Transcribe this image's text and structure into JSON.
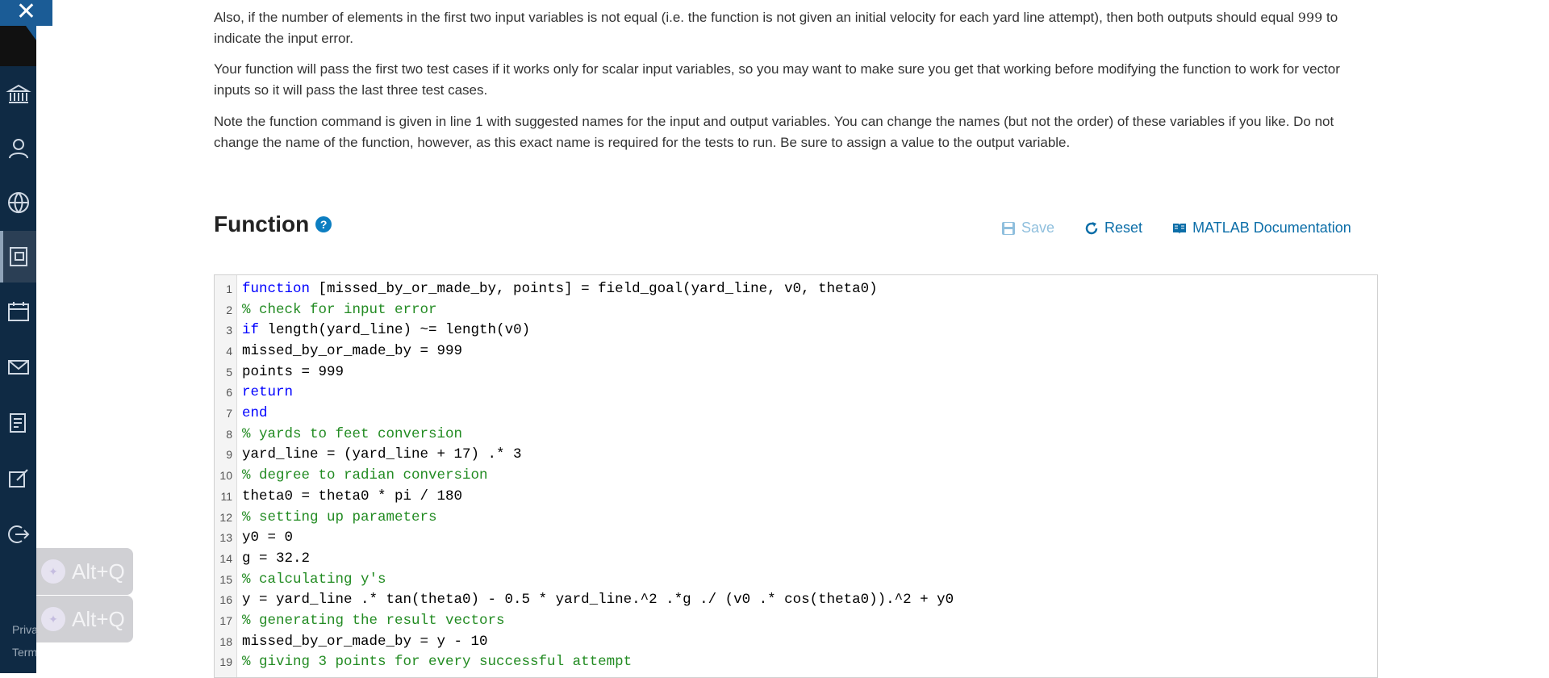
{
  "rail": {
    "close_glyph": "✕",
    "footer": [
      "Priva",
      "Term"
    ]
  },
  "overlays": {
    "altq_label": "Alt+Q"
  },
  "content": {
    "p1_a": "Also, if the number of elements in the first two input variables is not equal (i.e. the function is not given an initial velocity for each yard line attempt), then both outputs should equal",
    "p1_num": "999",
    "p1_b": " to indicate the input error.",
    "p2": "Your function will pass the first two test cases if it works only for scalar input variables, so you may want to make sure you get that working before modifying the function to work for vector inputs so it will pass the last three test cases.",
    "p3": "Note the function command is given in line 1 with suggested names for the input and output variables.  You can change the names (but not the order) of these variables if you like.  Do not change the name of the function, however, as this exact name is required for the tests to run.  Be sure to assign a value to the output variable."
  },
  "function_section": {
    "title": "Function",
    "save_label": "Save",
    "reset_label": "Reset",
    "docs_label": "MATLAB Documentation"
  },
  "code_lines": [
    {
      "n": "1",
      "kw": "function",
      "rest": " [missed_by_or_made_by, points] = field_goal(yard_line, v0, theta0)"
    },
    {
      "n": "2",
      "cm": "% check for input error"
    },
    {
      "n": "3",
      "kw": "if",
      "rest": " length(yard_line) ~= length(v0)"
    },
    {
      "n": "4",
      "rest": "missed_by_or_made_by = 999"
    },
    {
      "n": "5",
      "rest": "points = 999"
    },
    {
      "n": "6",
      "kw": "return"
    },
    {
      "n": "7",
      "kw": "end"
    },
    {
      "n": "8",
      "cm": "% yards to feet conversion"
    },
    {
      "n": "9",
      "rest": "yard_line = (yard_line + 17) .* 3"
    },
    {
      "n": "10",
      "cm": "% degree to radian conversion"
    },
    {
      "n": "11",
      "rest": "theta0 = theta0 * pi / 180"
    },
    {
      "n": "12",
      "cm": "% setting up parameters"
    },
    {
      "n": "13",
      "rest": "y0 = 0"
    },
    {
      "n": "14",
      "rest": "g = 32.2"
    },
    {
      "n": "15",
      "cm": "% calculating y's"
    },
    {
      "n": "16",
      "rest": "y = yard_line .* tan(theta0) - 0.5 * yard_line.^2 .*g ./ (v0 .* cos(theta0)).^2 + y0"
    },
    {
      "n": "17",
      "cm": "% generating the result vectors"
    },
    {
      "n": "18",
      "rest": "missed_by_or_made_by = y - 10"
    },
    {
      "n": "19",
      "cm": "% giving 3 points for every successful attempt"
    }
  ]
}
